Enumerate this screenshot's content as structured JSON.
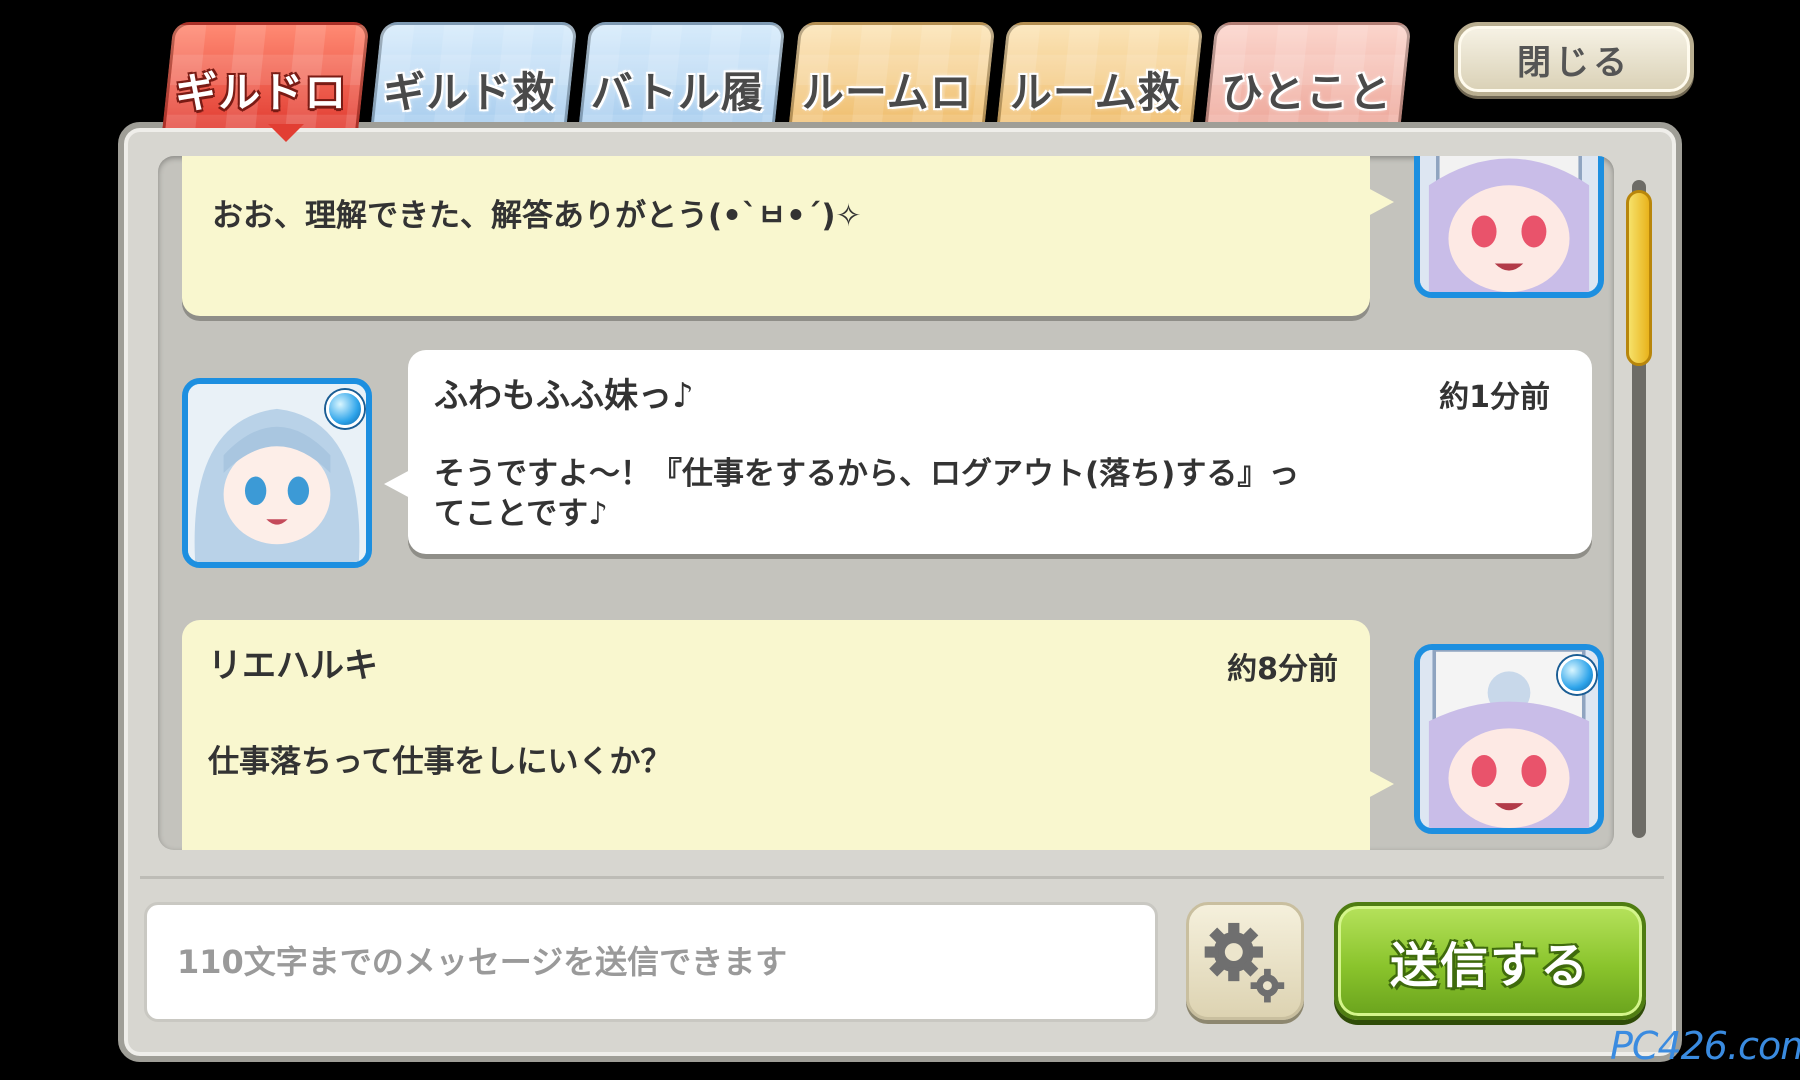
{
  "tabs": [
    {
      "label": "ギルドログ",
      "active": true
    },
    {
      "label": "ギルド救援"
    },
    {
      "label": "バトル履歴"
    },
    {
      "label": "ルームログ"
    },
    {
      "label": "ルーム救援"
    },
    {
      "label": "ひとこと"
    }
  ],
  "close_button": {
    "label": "閉じる"
  },
  "messages": [
    {
      "name": "",
      "time": "",
      "text": "おお、理解できた、解答ありがとう(•`ㅂ•´)✧",
      "side": "right"
    },
    {
      "name": "ふわもふふ妹っ♪",
      "time": "約1分前",
      "text_line1": "そうですよ～！『仕事をするから、ログアウト(落ち)する』っ",
      "text_line2": "てことです♪",
      "side": "left"
    },
    {
      "name": "リエハルキ",
      "time": "約8分前",
      "text": "仕事落ちって仕事をしにいくか？",
      "side": "right"
    }
  ],
  "input": {
    "placeholder": "110文字までのメッセージを送信できます"
  },
  "send_button": {
    "label": "送信する"
  },
  "watermark": "PC426.com",
  "colors": {
    "active_tab": "#e23e33",
    "send_green": "#8ac42c",
    "bubble_yellow": "#f9f7cf",
    "avatar_border": "#1d8fe0"
  }
}
